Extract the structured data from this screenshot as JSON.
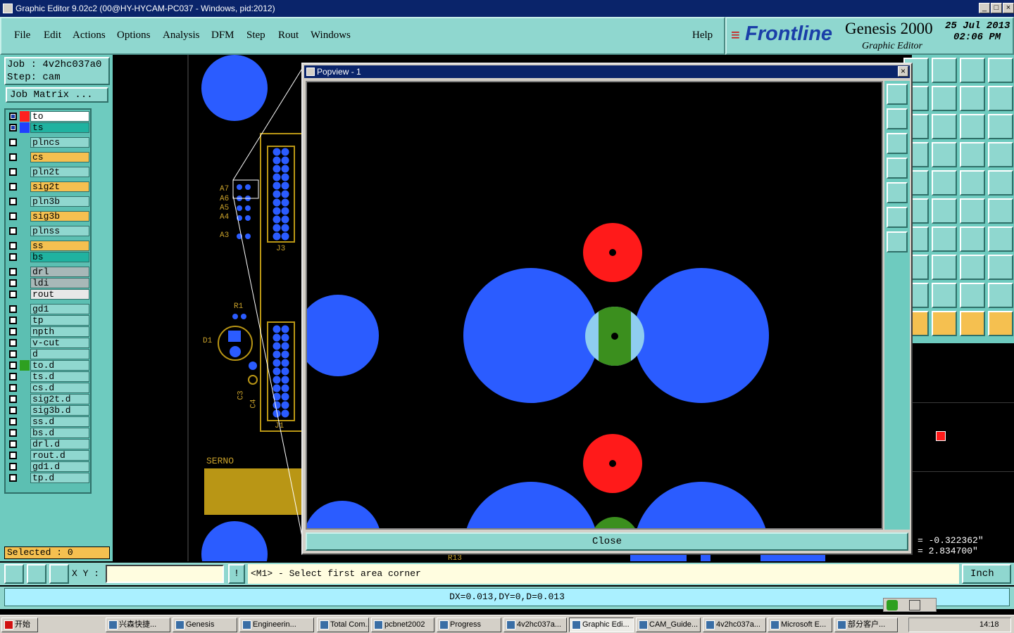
{
  "window": {
    "title": "Graphic Editor 9.02c2 (00@HY-HYCAM-PC037 - Windows, pid:2012)",
    "buttons": [
      "_",
      "□",
      "×"
    ]
  },
  "menu": {
    "items": [
      "File",
      "Edit",
      "Actions",
      "Options",
      "Analysis",
      "DFM",
      "Step",
      "Rout",
      "Windows"
    ],
    "help": "Help"
  },
  "brand": {
    "logo": "Frontline",
    "product": "Genesis 2000",
    "subtitle": "Graphic Editor",
    "date": "25 Jul 2013",
    "time": "02:06 PM"
  },
  "job": {
    "job": "Job : 4v2hc037a0",
    "step": "Step: cam",
    "matrix": "Job Matrix ..."
  },
  "layers": [
    {
      "name": "to",
      "color": "#ffffff",
      "swatch": "#ff2020",
      "checked": true,
      "highlight": "#ffffff"
    },
    {
      "name": "ts",
      "color": "#20b2a0",
      "swatch": "#2040ff",
      "checked": true
    },
    {
      "name": "plncs",
      "color": "#8fd7cf"
    },
    {
      "name": "cs",
      "color": "#f5c050"
    },
    {
      "name": "pln2t",
      "color": "#8fd7cf"
    },
    {
      "name": "sig2t",
      "color": "#f5c050"
    },
    {
      "name": "pln3b",
      "color": "#8fd7cf"
    },
    {
      "name": "sig3b",
      "color": "#f5c050"
    },
    {
      "name": "plnss",
      "color": "#8fd7cf"
    },
    {
      "name": "ss",
      "color": "#f5c050"
    },
    {
      "name": "bs",
      "color": "#20b2a0"
    },
    {
      "name": "drl",
      "color": "#a8b8b8"
    },
    {
      "name": "ldi",
      "color": "#a8b8b8"
    },
    {
      "name": "rout",
      "color": "#e8e8e8"
    },
    {
      "name": "gd1",
      "color": "#8fd7cf"
    },
    {
      "name": "tp",
      "color": "#8fd7cf"
    },
    {
      "name": "npth",
      "color": "#8fd7cf"
    },
    {
      "name": "v-cut",
      "color": "#8fd7cf"
    },
    {
      "name": "d",
      "color": "#8fd7cf"
    },
    {
      "name": "to.d",
      "color": "#8fd7cf",
      "swatch": "#2ea020"
    },
    {
      "name": "ts.d",
      "color": "#8fd7cf"
    },
    {
      "name": "cs.d",
      "color": "#8fd7cf"
    },
    {
      "name": "sig2t.d",
      "color": "#8fd7cf"
    },
    {
      "name": "sig3b.d",
      "color": "#8fd7cf"
    },
    {
      "name": "ss.d",
      "color": "#8fd7cf"
    },
    {
      "name": "bs.d",
      "color": "#8fd7cf"
    },
    {
      "name": "drl.d",
      "color": "#8fd7cf"
    },
    {
      "name": "rout.d",
      "color": "#8fd7cf"
    },
    {
      "name": "gd1.d",
      "color": "#8fd7cf"
    },
    {
      "name": "tp.d",
      "color": "#8fd7cf"
    }
  ],
  "selected": "Selected : 0",
  "board": {
    "labels": {
      "a7": "A7",
      "a6": "A6",
      "a5": "A5",
      "a4": "A4",
      "a3": "A3",
      "j3": "J3",
      "r1": "R1",
      "d1": "D1",
      "c3": "C3",
      "c4": "C4",
      "serno": "SERNO",
      "r13": "R13",
      "j1": "J1"
    }
  },
  "popview": {
    "title": "Popview - 1",
    "close": "Close"
  },
  "coords": {
    "x": "= -0.322362\"",
    "y": "= 2.834700\""
  },
  "status": {
    "xy_label": "X Y :",
    "xy_value": "",
    "prompt": "<M1> - Select first area corner",
    "unit": "Inch"
  },
  "info": {
    "delta": "DX=0.013,DY=0,D=0.013"
  },
  "taskbar": {
    "start": "开始",
    "items": [
      "兴森快捷...",
      "Genesis",
      "Engineerin...",
      "Total Com...",
      "pcbnet2002",
      "Progress",
      "4v2hc037a...",
      "Graphic Edi...",
      "CAM_Guide...",
      "4v2hc037a...",
      "Microsoft E...",
      "部分客户..."
    ],
    "clock": "14:18"
  },
  "colors": {
    "teal": "#8fd7cf",
    "blue": "#2b5cff",
    "red": "#ff1a1a",
    "green": "#3b8f1e",
    "gold": "#c8a02a"
  }
}
